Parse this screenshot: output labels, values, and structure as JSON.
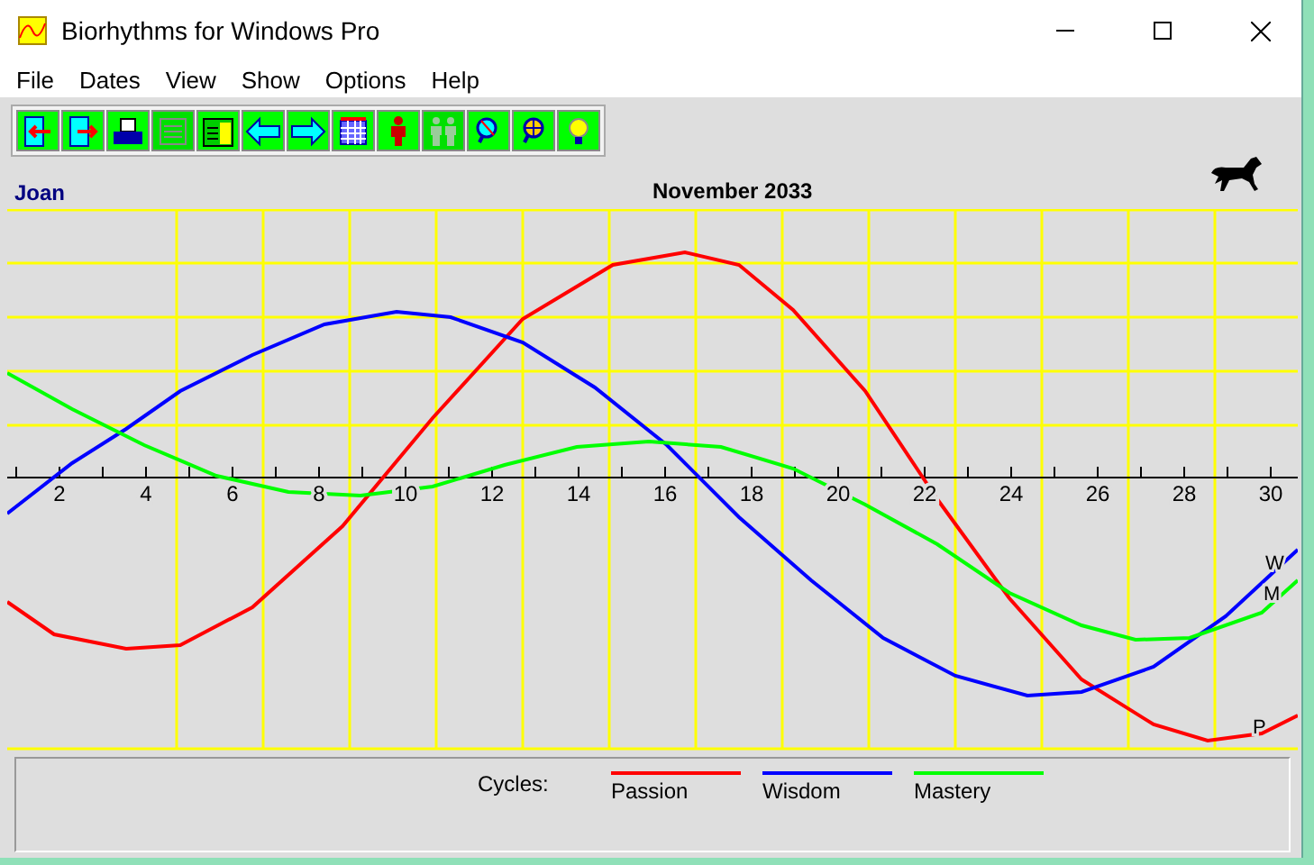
{
  "window": {
    "title": "Biorhythms for Windows Pro"
  },
  "menu": [
    "File",
    "Dates",
    "View",
    "Show",
    "Options",
    "Help"
  ],
  "toolbar": [
    {
      "disabled": false
    },
    {
      "disabled": false
    },
    {
      "disabled": false
    },
    {
      "disabled": true
    },
    {
      "disabled": false
    },
    {
      "disabled": false
    },
    {
      "disabled": false
    },
    {
      "disabled": false
    },
    {
      "disabled": false
    },
    {
      "disabled": true
    },
    {
      "disabled": false
    },
    {
      "disabled": false
    },
    {
      "disabled": false
    }
  ],
  "chart": {
    "person": "Joan",
    "month": "November 2033",
    "day_labels": [
      "2",
      "4",
      "6",
      "8",
      "10",
      "12",
      "14",
      "16",
      "18",
      "20",
      "22",
      "24",
      "26",
      "28",
      "30"
    ],
    "curve_labels": [
      "W",
      "M",
      "P"
    ]
  },
  "legend": {
    "title": "Cycles:",
    "cycles": [
      {
        "name": "Passion",
        "color": "#ff0000"
      },
      {
        "name": "Wisdom",
        "color": "#0000ff"
      },
      {
        "name": "Mastery",
        "color": "#00ff00"
      }
    ]
  }
}
